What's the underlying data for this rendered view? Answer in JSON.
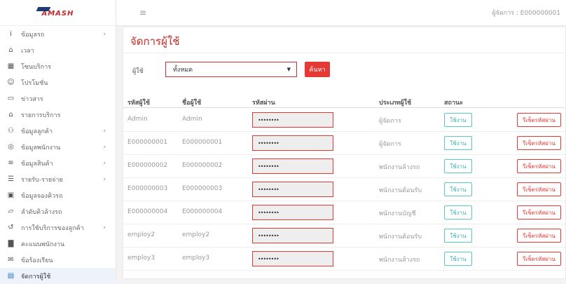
{
  "brand": {
    "logo_text": "AMASH"
  },
  "header": {
    "menu_icon": "hamburger-icon",
    "user_info": "ผู้จัดการ : E000000001"
  },
  "sidebar": {
    "items": [
      {
        "label": "ข้อมูลรถ",
        "icon": "info-icon",
        "has_chevron": true
      },
      {
        "label": "เวลา",
        "icon": "bank-icon",
        "has_chevron": false
      },
      {
        "label": "โซนบริการ",
        "icon": "grid-icon",
        "has_chevron": false
      },
      {
        "label": "โปรโมชั่น",
        "icon": "user-icon",
        "has_chevron": false
      },
      {
        "label": "ข่าวสาร",
        "icon": "card-icon",
        "has_chevron": false
      },
      {
        "label": "รายการบริการ",
        "icon": "bank-icon",
        "has_chevron": false
      },
      {
        "label": "ข้อมูลลูกค้า",
        "icon": "users-icon",
        "has_chevron": true
      },
      {
        "label": "ข้อมูลพนักงาน",
        "icon": "user-circle-icon",
        "has_chevron": true
      },
      {
        "label": "ข้อมูลสินค้า",
        "icon": "list-icon",
        "has_chevron": true
      },
      {
        "label": "รายรับ-รายจ่าย",
        "icon": "money-icon",
        "has_chevron": true
      },
      {
        "label": "ข้อมูลจองคิวรถ",
        "icon": "calendar-icon",
        "has_chevron": false
      },
      {
        "label": "ลำดับคิวล้างรถ",
        "icon": "car-icon",
        "has_chevron": false
      },
      {
        "label": "การใช้บริการของลูกค้า",
        "icon": "history-icon",
        "has_chevron": true
      },
      {
        "label": "คะแนนพนักงาน",
        "icon": "chart-icon",
        "has_chevron": false
      },
      {
        "label": "ข้อร้องเรียน",
        "icon": "complaint-icon",
        "has_chevron": false
      },
      {
        "label": "จัดการผู้ใช้",
        "icon": "user-card-icon",
        "has_chevron": false,
        "active": true
      }
    ]
  },
  "page": {
    "title": "จัดการผู้ใช้",
    "filter": {
      "label": "ผู้ใช้",
      "selected": "ทั้งหมด",
      "button": "ค้นหา"
    }
  },
  "table": {
    "headers": [
      "รหัสผู้ใช้",
      "ชื่อผู้ใช้",
      "รหัสผ่าน",
      "ประเภทผู้ใช้",
      "สถานะ"
    ],
    "rows": [
      {
        "id": "Admin",
        "name": "Admin",
        "password": "••••••••",
        "type": "ผู้จัดการ",
        "status": "ใช้งาน",
        "reset": "รีเซ็ตรหัสผ่าน"
      },
      {
        "id": "E000000001",
        "name": "E000000001",
        "password": "••••••••",
        "type": "ผู้จัดการ",
        "status": "ใช้งาน",
        "reset": "รีเซ็ตรหัสผ่าน"
      },
      {
        "id": "E000000002",
        "name": "E000000002",
        "password": "••••••••",
        "type": "พนักงานล้างรถ",
        "status": "ใช้งาน",
        "reset": "รีเซ็ตรหัสผ่าน"
      },
      {
        "id": "E000000003",
        "name": "E000000003",
        "password": "••••••••",
        "type": "พนักงานต้อนรับ",
        "status": "ใช้งาน",
        "reset": "รีเซ็ตรหัสผ่าน"
      },
      {
        "id": "E000000004",
        "name": "E000000004",
        "password": "••••••••",
        "type": "พนักงานบัญชี",
        "status": "ใช้งาน",
        "reset": "รีเซ็ตรหัสผ่าน"
      },
      {
        "id": "employ2",
        "name": "employ2",
        "password": "••••••••",
        "type": "พนักงานต้อนรับ",
        "status": "ใช้งาน",
        "reset": "รีเซ็ตรหัสผ่าน"
      },
      {
        "id": "employ3",
        "name": "employ3",
        "password": "••••••••",
        "type": "พนักงานล้างรถ",
        "status": "ใช้งาน",
        "reset": "รีเซ็ตรหัสผ่าน"
      }
    ]
  },
  "colors": {
    "accent": "#e53935",
    "status": "#3aafb3",
    "active_bg": "#eef3fb"
  }
}
